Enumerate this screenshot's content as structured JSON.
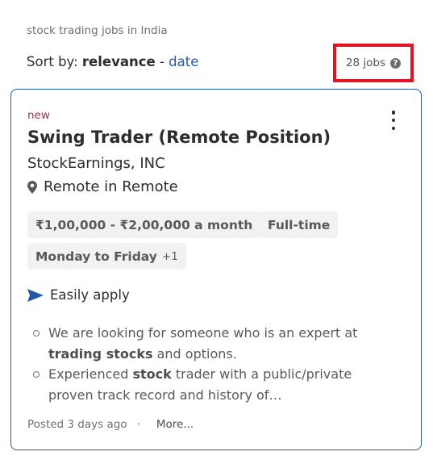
{
  "search_caption": "stock trading jobs in India",
  "sort": {
    "prefix": "Sort by: ",
    "active": "relevance",
    "separator": " - ",
    "option": "date"
  },
  "job_count": {
    "label": "28 jobs",
    "help_glyph": "?",
    "highlight_color": "#e5131f"
  },
  "card": {
    "badge": "new",
    "title": "Swing Trader (Remote Position)",
    "company": "StockEarnings, INC",
    "location": "Remote in Remote",
    "tags": {
      "salary": "₹1,00,000 - ₹2,00,000 a month",
      "job_type": "Full-time",
      "schedule": "Monday to Friday",
      "schedule_more": "+1"
    },
    "easily_apply": "Easily apply",
    "snippet": [
      {
        "before": "We are looking for someone who is an expert at ",
        "bold": "trading stocks",
        "after": " and options."
      },
      {
        "before": "Experienced ",
        "bold": "stock",
        "after": " trader with a public/private proven track record and history of…"
      }
    ],
    "posted": "Posted 3 days ago",
    "separator": "·",
    "more": "More...",
    "accent_color": "#2557a7"
  }
}
